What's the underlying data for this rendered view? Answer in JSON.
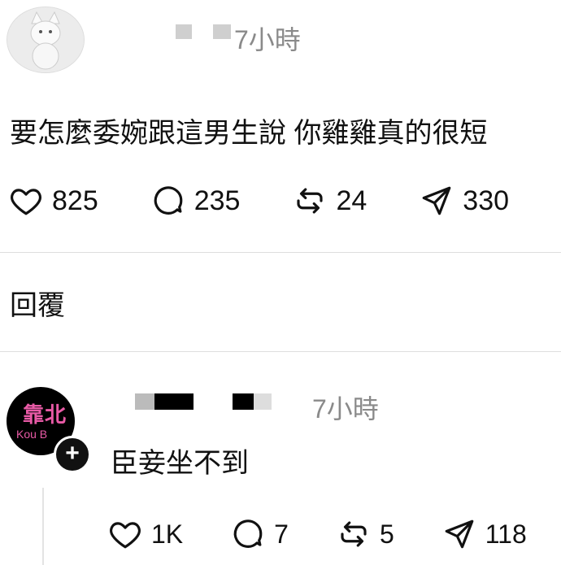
{
  "post": {
    "time": "7小時",
    "text": "要怎麼委婉跟這男生說 你雞雞真的很短",
    "likes": "825",
    "comments": "235",
    "reposts": "24",
    "shares": "330"
  },
  "replies_label": "回覆",
  "reply": {
    "avatar_title": "靠北",
    "avatar_subtitle": "Kou B",
    "time": "7小時",
    "text": "臣妾坐不到",
    "likes": "1K",
    "comments": "7",
    "reposts": "5",
    "shares": "118"
  },
  "icons": [
    "heart-icon",
    "comment-icon",
    "repost-icon",
    "send-icon",
    "plus-icon"
  ]
}
